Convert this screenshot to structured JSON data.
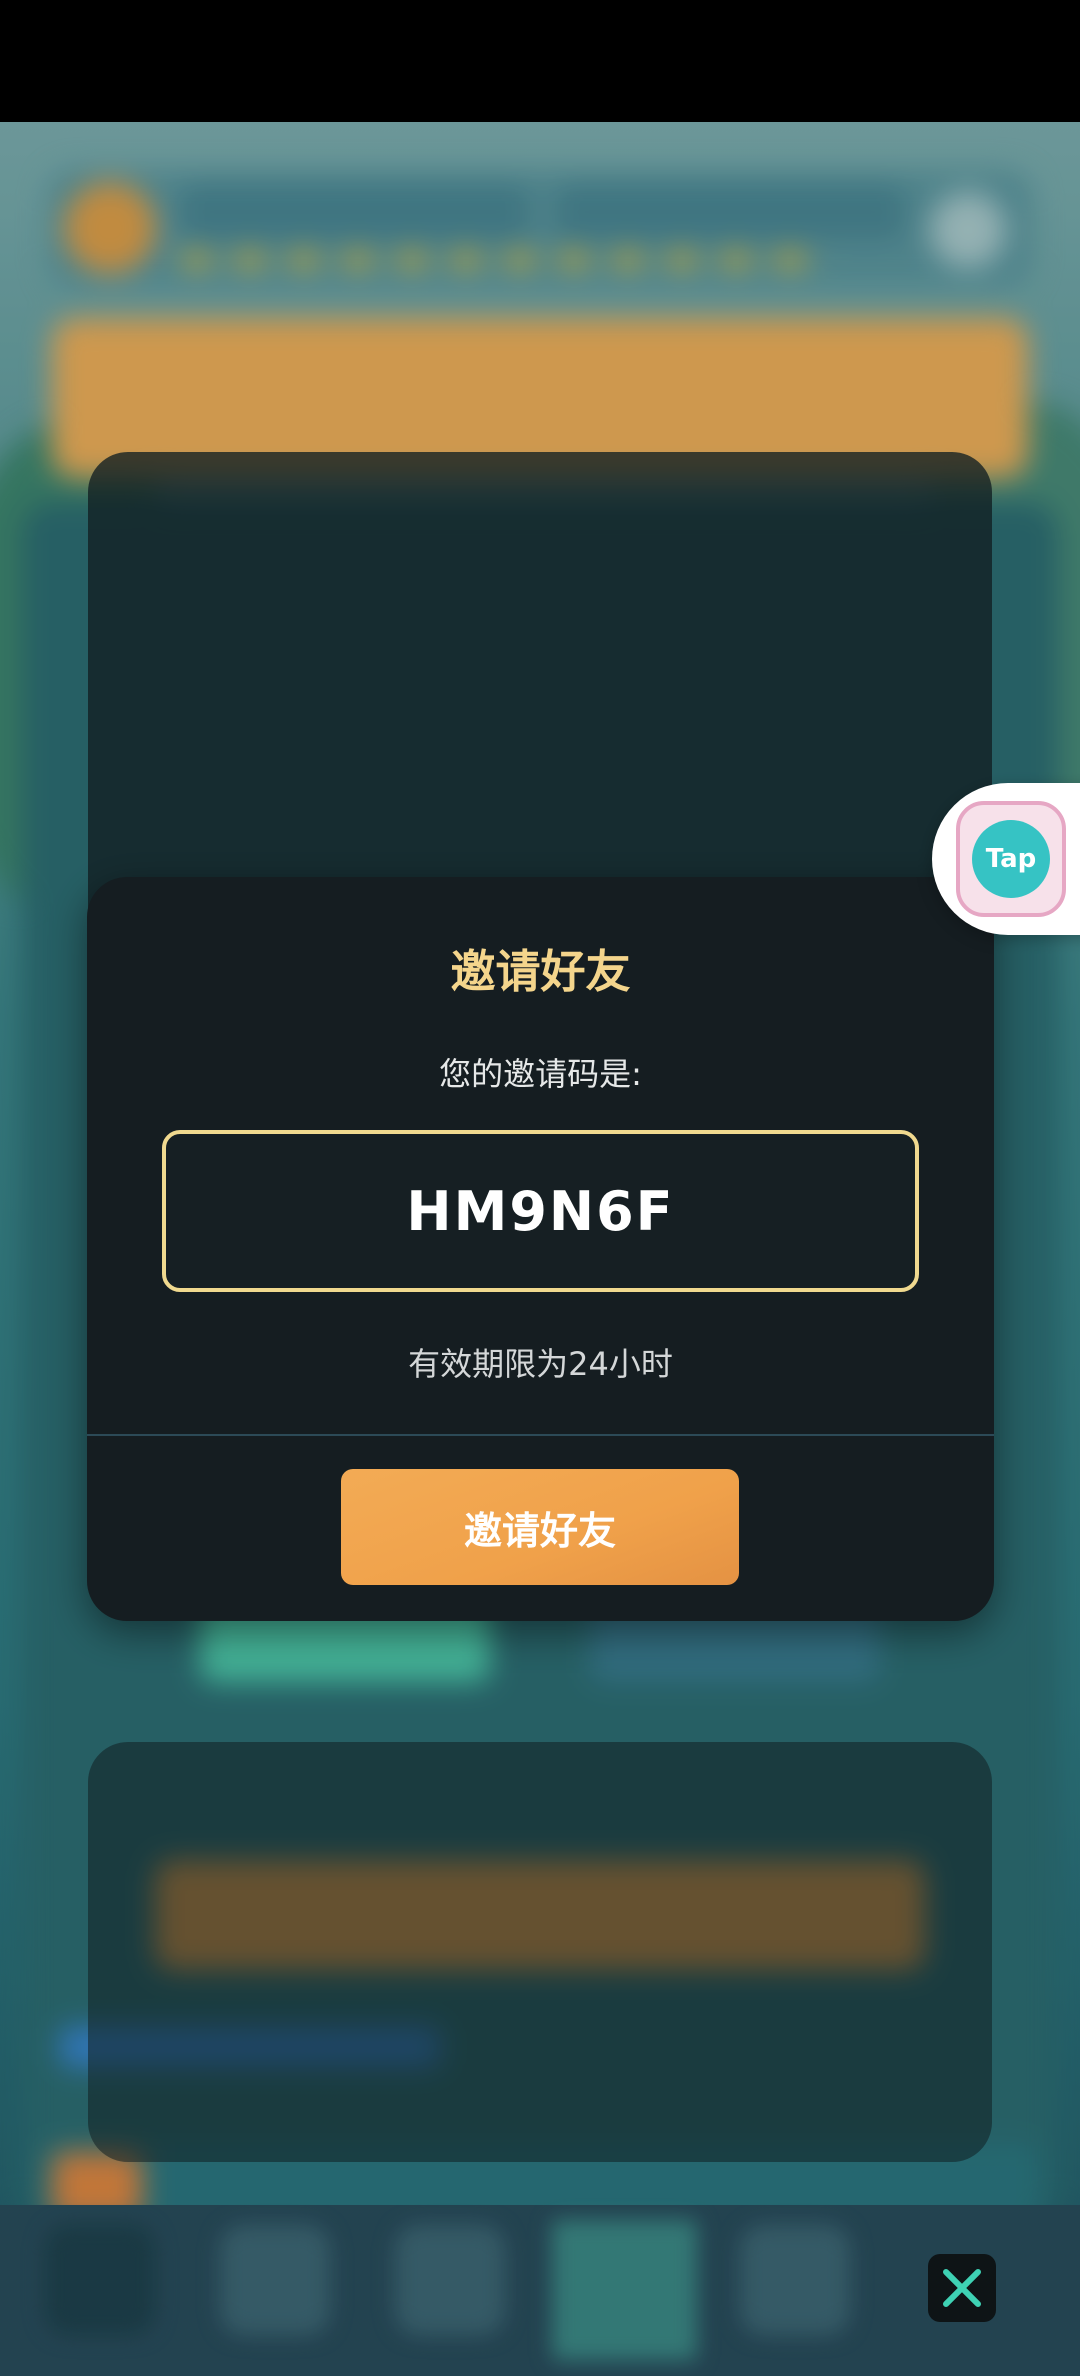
{
  "modal": {
    "title": "邀请好友",
    "subtitle": "您的邀请码是:",
    "invite_code": "HM9N6F",
    "validity": "有效期限为24小时",
    "button_label": "邀请好友"
  },
  "floating_widget": {
    "label": "Tap"
  },
  "close_button": {
    "icon": "close-icon"
  },
  "colors": {
    "accent_gold": "#f4d58c",
    "button_orange": "#f0a14a",
    "modal_bg": "#151d21",
    "close_x": "#3ed2b4"
  }
}
